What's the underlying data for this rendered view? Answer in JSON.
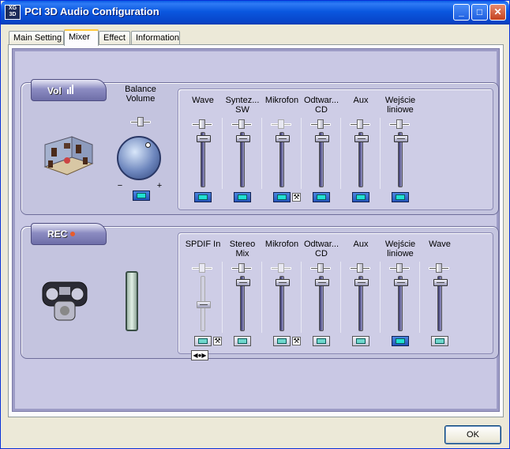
{
  "window": {
    "title": "PCI 3D Audio Configuration",
    "icon_text": "XG 3D",
    "icon_name": "audio-app-icon",
    "controls": [
      "minimize",
      "maximize",
      "close"
    ]
  },
  "tabs": [
    {
      "label": "Main Setting",
      "active": false
    },
    {
      "label": "Mixer",
      "active": true
    },
    {
      "label": "Effect",
      "active": false
    },
    {
      "label": "Information",
      "active": false
    }
  ],
  "volume": {
    "header": "Vol",
    "master": {
      "label_line1": "Balance",
      "label_line2": "Volume",
      "minus": "−",
      "plus": "+"
    },
    "channels": [
      {
        "label1": "Wave",
        "label2": "",
        "level": 0.95,
        "balance_enabled": true,
        "mute": "on",
        "settings": false
      },
      {
        "label1": "Syntez...",
        "label2": "SW",
        "level": 0.95,
        "balance_enabled": true,
        "mute": "on",
        "settings": false
      },
      {
        "label1": "Mikrofon",
        "label2": "",
        "level": 0.95,
        "balance_enabled": false,
        "mute": "on",
        "settings": true
      },
      {
        "label1": "Odtwar...",
        "label2": "CD",
        "level": 0.95,
        "balance_enabled": true,
        "mute": "on",
        "settings": false
      },
      {
        "label1": "Aux",
        "label2": "",
        "level": 0.95,
        "balance_enabled": true,
        "mute": "on",
        "settings": false
      },
      {
        "label1": "Wejście",
        "label2": "liniowe",
        "level": 0.95,
        "balance_enabled": true,
        "mute": "on",
        "settings": false
      }
    ]
  },
  "record": {
    "header": "REC",
    "channels": [
      {
        "label1": "SPDIF In",
        "label2": "",
        "level": 0.5,
        "balance_enabled": false,
        "enabled": false,
        "mute": "off",
        "settings": true
      },
      {
        "label1": "Stereo",
        "label2": "Mix",
        "level": 0.95,
        "balance_enabled": true,
        "enabled": true,
        "mute": "off",
        "settings": false
      },
      {
        "label1": "Mikrofon",
        "label2": "",
        "level": 0.95,
        "balance_enabled": false,
        "enabled": true,
        "mute": "off",
        "settings": true
      },
      {
        "label1": "Odtwar...",
        "label2": "CD",
        "level": 0.95,
        "balance_enabled": true,
        "enabled": true,
        "mute": "off",
        "settings": false
      },
      {
        "label1": "Aux",
        "label2": "",
        "level": 0.95,
        "balance_enabled": true,
        "enabled": true,
        "mute": "off",
        "settings": false
      },
      {
        "label1": "Wejście",
        "label2": "liniowe",
        "level": 0.95,
        "balance_enabled": true,
        "enabled": true,
        "mute": "on",
        "settings": false
      },
      {
        "label1": "Wave",
        "label2": "",
        "level": 0.95,
        "balance_enabled": true,
        "enabled": true,
        "mute": "off",
        "settings": false
      }
    ]
  },
  "buttons": {
    "ok": "OK"
  }
}
